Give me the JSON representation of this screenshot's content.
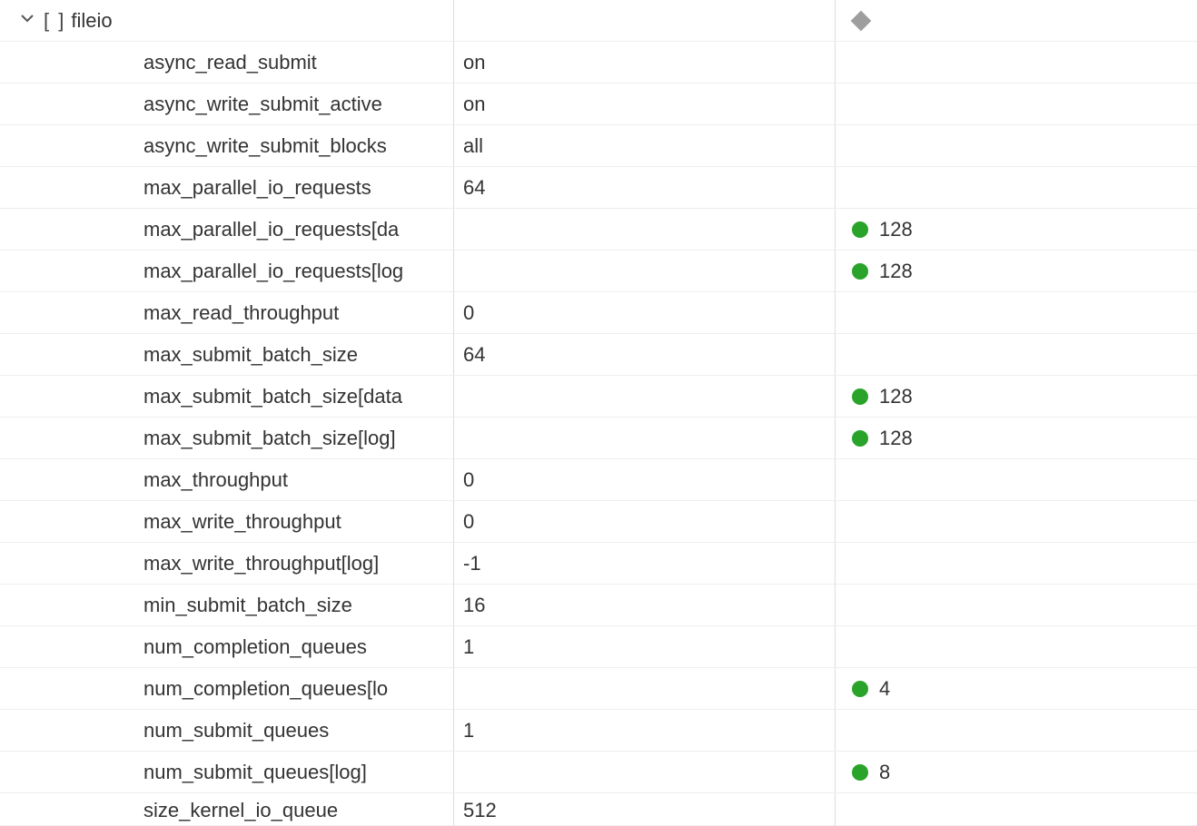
{
  "section": {
    "name": "fileio",
    "bracket": "[ ]",
    "header_icon": "diamond-icon"
  },
  "rows": [
    {
      "name": "async_read_submit",
      "value": "on",
      "indicator": null,
      "ind_value": ""
    },
    {
      "name": "async_write_submit_active",
      "value": "on",
      "indicator": null,
      "ind_value": ""
    },
    {
      "name": "async_write_submit_blocks",
      "value": "all",
      "indicator": null,
      "ind_value": ""
    },
    {
      "name": "max_parallel_io_requests",
      "value": "64",
      "indicator": null,
      "ind_value": ""
    },
    {
      "name": "max_parallel_io_requests[da",
      "value": "",
      "indicator": "green",
      "ind_value": "128"
    },
    {
      "name": "max_parallel_io_requests[log",
      "value": "",
      "indicator": "green",
      "ind_value": "128"
    },
    {
      "name": "max_read_throughput",
      "value": "0",
      "indicator": null,
      "ind_value": ""
    },
    {
      "name": "max_submit_batch_size",
      "value": "64",
      "indicator": null,
      "ind_value": ""
    },
    {
      "name": "max_submit_batch_size[data",
      "value": "",
      "indicator": "green",
      "ind_value": "128"
    },
    {
      "name": "max_submit_batch_size[log]",
      "value": "",
      "indicator": "green",
      "ind_value": "128"
    },
    {
      "name": "max_throughput",
      "value": "0",
      "indicator": null,
      "ind_value": ""
    },
    {
      "name": "max_write_throughput",
      "value": "0",
      "indicator": null,
      "ind_value": ""
    },
    {
      "name": "max_write_throughput[log]",
      "value": "-1",
      "indicator": null,
      "ind_value": ""
    },
    {
      "name": "min_submit_batch_size",
      "value": "16",
      "indicator": null,
      "ind_value": ""
    },
    {
      "name": "num_completion_queues",
      "value": "1",
      "indicator": null,
      "ind_value": ""
    },
    {
      "name": "num_completion_queues[lo",
      "value": "",
      "indicator": "green",
      "ind_value": "4"
    },
    {
      "name": "num_submit_queues",
      "value": "1",
      "indicator": null,
      "ind_value": ""
    },
    {
      "name": "num_submit_queues[log]",
      "value": "",
      "indicator": "green",
      "ind_value": "8"
    },
    {
      "name": "size_kernel_io_queue",
      "value": "512",
      "indicator": null,
      "ind_value": ""
    }
  ]
}
